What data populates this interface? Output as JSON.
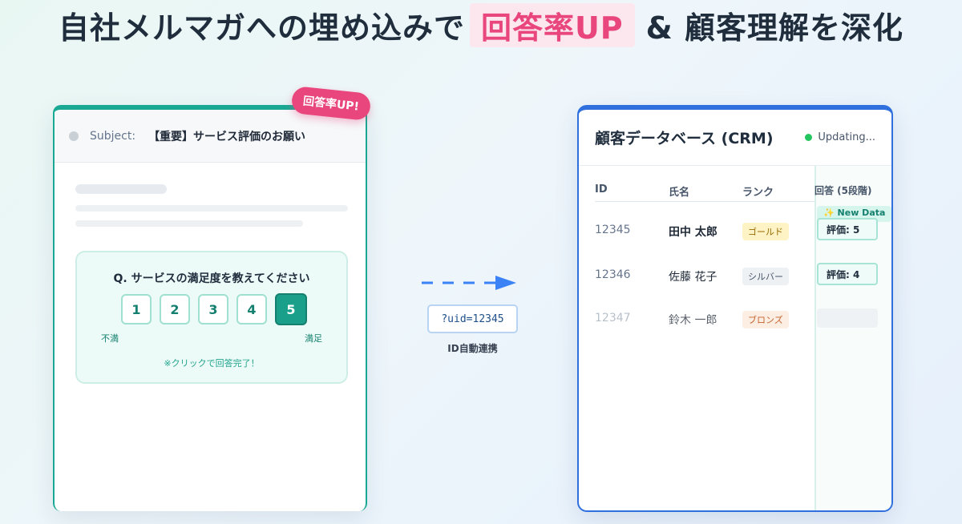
{
  "headline": {
    "prefix": "自社メルマガへの埋め込みで",
    "highlight": "回答率UP",
    "suffix": "& 顧客理解を深化"
  },
  "email": {
    "subject_label": "Subject:",
    "subject_text": "【重要】サービス評価のお願い",
    "badge": "回答率UP!",
    "question": "Q. サービスの満足度を教えてください",
    "ratings": [
      "1",
      "2",
      "3",
      "4",
      "5"
    ],
    "selected_rating": "5",
    "scale_low": "不満",
    "scale_high": "満足",
    "note": "※クリックで回答完了！"
  },
  "connector": {
    "uid": "?uid=12345",
    "label": "ID自動連携"
  },
  "crm": {
    "title": "顧客データベース (CRM)",
    "status": "Updating...",
    "columns": {
      "id": "ID",
      "name": "氏名",
      "rank": "ランク",
      "response": "回答 (5段階)"
    },
    "new_data_label": "✨ New Data",
    "rows": [
      {
        "id": "12345",
        "name": "田中 太郎",
        "rank": "ゴールド",
        "response": "評価: 5"
      },
      {
        "id": "12346",
        "name": "佐藤 花子",
        "rank": "シルバー",
        "response": "評価: 4"
      },
      {
        "id": "12347",
        "name": "鈴木 一郎",
        "rank": "ブロンズ",
        "response": ""
      }
    ]
  },
  "colors": {
    "accent_teal": "#19a894",
    "accent_pink": "#e8467c",
    "accent_blue": "#2f6fde"
  }
}
